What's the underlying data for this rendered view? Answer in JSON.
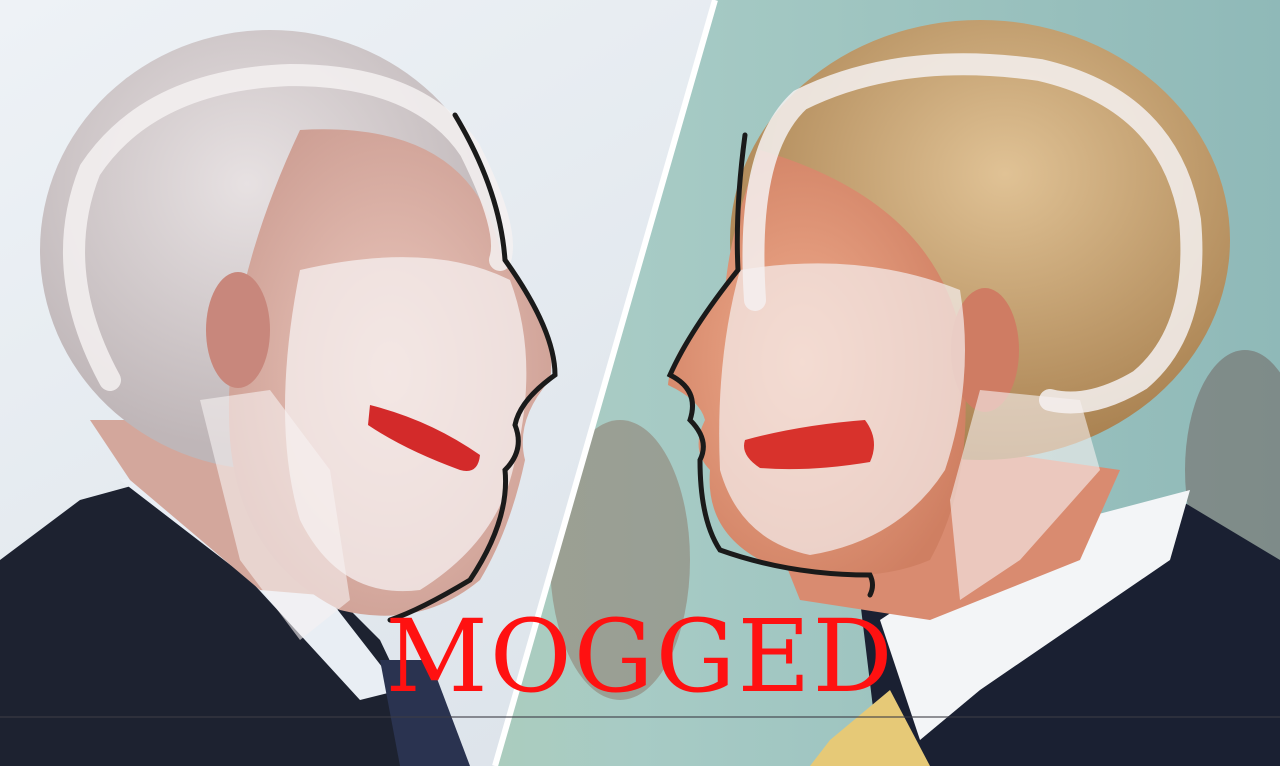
{
  "caption": {
    "text": "MOGGED",
    "color": "#ff1111"
  },
  "left_figure": {
    "subject": "man-in-profile-facing-right",
    "hair_color": "#d9d3d4",
    "skin_color": "#e2b8ae",
    "suit_color": "#1d2230",
    "overlay_color": "#f2ecec",
    "tongue_color": "#d32a2a"
  },
  "right_figure": {
    "subject": "man-in-profile-facing-left",
    "hair_color": "#c9a070",
    "skin_color": "#e59a7c",
    "suit_color": "#1a2032",
    "overlay_color": "#f2ecec",
    "tongue_color": "#d8322c",
    "tie_color": "#e6c977"
  },
  "background": {
    "left": "#e4eaf0",
    "right": "#9fc8c4"
  }
}
